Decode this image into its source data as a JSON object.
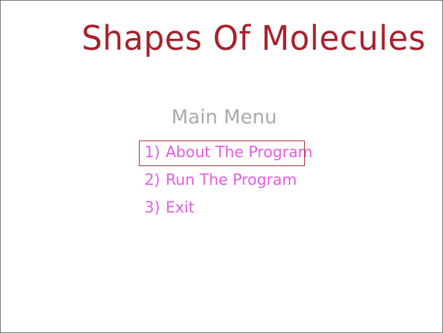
{
  "app": {
    "title": "Shapes Of Molecules"
  },
  "menu": {
    "heading": "Main Menu",
    "items": [
      {
        "number": "1)",
        "label": "About The Program",
        "selected": true
      },
      {
        "number": "2)",
        "label": "Run The Program",
        "selected": false
      },
      {
        "number": "3)",
        "label": "Exit",
        "selected": false
      }
    ]
  },
  "colors": {
    "title": "#a8222c",
    "heading": "#a9a9a9",
    "menu_item": "#e45ce6",
    "selection_box": "#a8222c",
    "background": "#ffffff",
    "window_border": "#6e6e6e"
  }
}
